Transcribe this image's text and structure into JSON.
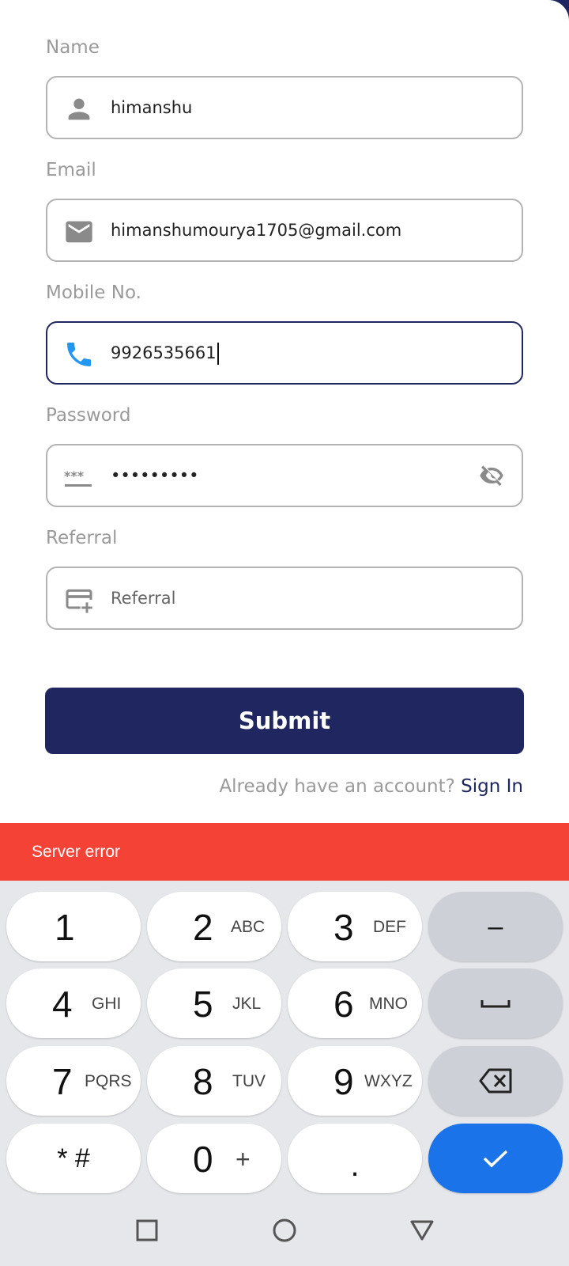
{
  "form": {
    "name": {
      "label": "Name",
      "value": "himanshu",
      "icon": "person-icon"
    },
    "email": {
      "label": "Email",
      "value": "himanshumourya1705@gmail.com",
      "icon": "mail-icon"
    },
    "mobile": {
      "label": "Mobile No.",
      "value": "9926535661",
      "icon": "phone-icon"
    },
    "password": {
      "label": "Password",
      "value": "•••••••••",
      "icon": "password-icon",
      "toggle_icon": "eye-off-icon"
    },
    "referral": {
      "label": "Referral",
      "placeholder": "Referral",
      "icon": "card-plus-icon"
    }
  },
  "submit_label": "Submit",
  "signin": {
    "prompt": "Already have an account?",
    "link": "Sign In"
  },
  "snackbar": {
    "text": "Server error",
    "color": "#f44336"
  },
  "keyboard": {
    "keys": [
      {
        "main": "1",
        "sub": ""
      },
      {
        "main": "2",
        "sub": "ABC"
      },
      {
        "main": "3",
        "sub": "DEF"
      },
      {
        "main": "–",
        "sub": ""
      },
      {
        "main": "4",
        "sub": "GHI"
      },
      {
        "main": "5",
        "sub": "JKL"
      },
      {
        "main": "6",
        "sub": "MNO"
      },
      {
        "main": "7",
        "sub": "PQRS"
      },
      {
        "main": "8",
        "sub": "TUV"
      },
      {
        "main": "9",
        "sub": "WXYZ"
      },
      {
        "main": "* #",
        "sub": ""
      },
      {
        "main": "0",
        "sub": "+"
      },
      {
        "main": ".",
        "sub": ""
      }
    ]
  },
  "colors": {
    "brand": "#202760",
    "accent": "#1a73e8",
    "error": "#f44336",
    "phone_icon": "#2196f3"
  }
}
